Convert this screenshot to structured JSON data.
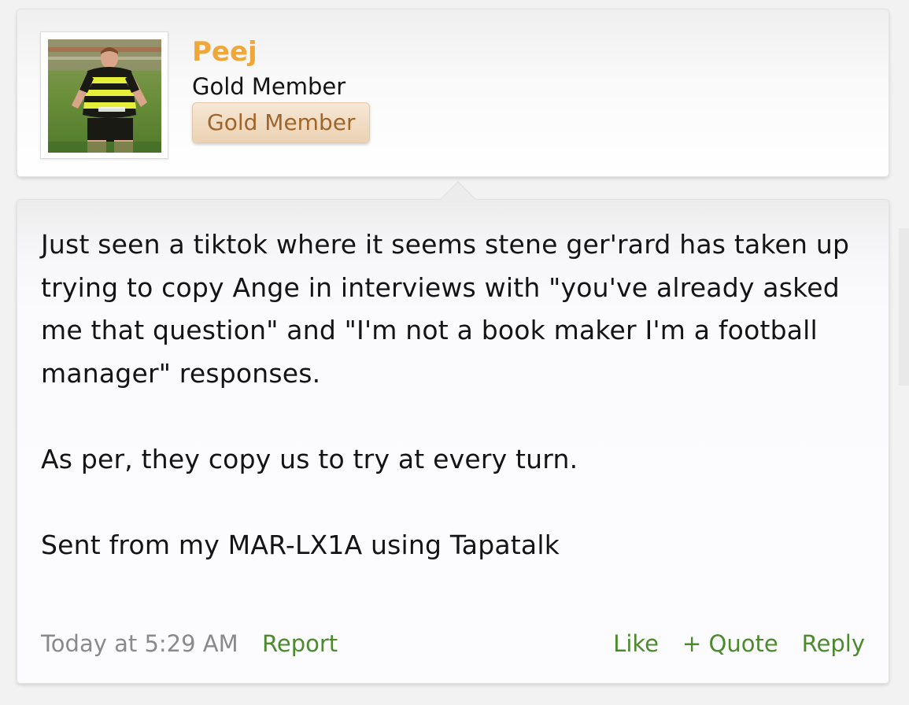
{
  "user": {
    "name": "Peej",
    "title": "Gold Member",
    "banner": "Gold Member",
    "avatar": "avatar-photo"
  },
  "message": {
    "body": "Just seen a tiktok where it seems stene ger'rard has taken up trying to copy Ange in interviews with \"you've already asked me that question\" and \"I'm not a book maker I'm a football manager\" responses.\n\nAs per, they copy us to try at every turn.\n\nSent from my MAR-LX1A using Tapatalk"
  },
  "footer": {
    "timestamp": "Today at 5:29 AM",
    "report": "Report",
    "like": "Like",
    "quote": "+ Quote",
    "reply": "Reply"
  },
  "colors": {
    "username": "#f0a73a",
    "link": "#4c8a2e",
    "banner_text": "#a0652a",
    "timestamp": "#8a8a8a"
  }
}
